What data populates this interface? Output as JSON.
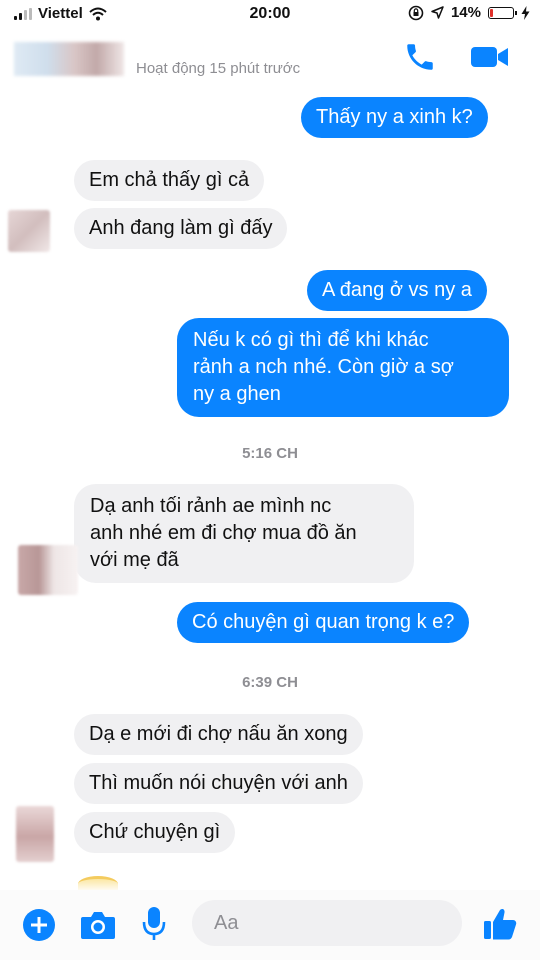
{
  "status": {
    "carrier": "Viettel",
    "time": "20:00",
    "battery": "14%",
    "battery_level": 0.14
  },
  "header": {
    "name": "",
    "activity": "Hoạt động 15 phút trước",
    "icons": [
      "phone-icon",
      "video-call-icon"
    ]
  },
  "messages": [
    {
      "side": "out",
      "text": "Thấy ny a xinh k?"
    },
    {
      "side": "in",
      "text": "Em chả thấy gì cả"
    },
    {
      "side": "in",
      "text": "Anh đang làm gì đấy"
    },
    {
      "side": "out",
      "text": "A đang ở vs ny a"
    },
    {
      "side": "out",
      "lines": [
        "Nếu k có gì thì để khi khác",
        "rảnh a nch nhé. Còn giờ a sợ",
        "ny a ghen"
      ]
    },
    {
      "side": "in",
      "lines": [
        "Dạ anh tối rảnh ae mình nc",
        "anh nhé em đi chợ mua đồ ăn",
        "với mẹ đã"
      ]
    },
    {
      "side": "out",
      "text": "Có chuyện gì quan trọng k e?"
    },
    {
      "side": "in",
      "text": "Dạ e mới đi chợ nấu ăn xong"
    },
    {
      "side": "in",
      "text": "Thì muốn nói chuyện với anh"
    },
    {
      "side": "in",
      "text": "Chứ chuyện gì"
    }
  ],
  "timestamps": [
    "5:16 CH",
    "6:39 CH"
  ],
  "composer": {
    "placeholder": "Aa",
    "icons": [
      "plus-icon",
      "camera-icon",
      "microphone-icon",
      "thumbs-up-icon"
    ]
  },
  "colors": {
    "accent": "#0a84ff",
    "incoming_bubble": "#f0f0f2",
    "battery_low": "#e0302a"
  }
}
